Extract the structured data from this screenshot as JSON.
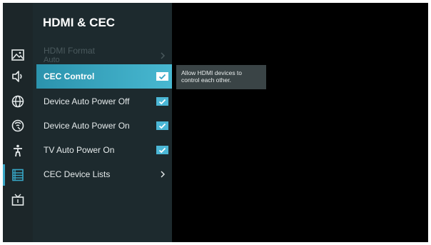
{
  "sidebar": {
    "icons": [
      {
        "name": "picture-icon"
      },
      {
        "name": "sound-icon"
      },
      {
        "name": "network-icon"
      },
      {
        "name": "wifi-settings-icon"
      },
      {
        "name": "accessibility-icon"
      },
      {
        "name": "general-settings-icon",
        "active": true
      },
      {
        "name": "tv-channels-icon"
      }
    ],
    "accent_color": "#37a6c6"
  },
  "menu": {
    "title": "HDMI & CEC",
    "items": [
      {
        "label": "HDMI Format",
        "sub": "Auto",
        "type": "link",
        "disabled": true
      },
      {
        "label": "CEC Control",
        "type": "checkbox",
        "checked": true,
        "selected": true
      },
      {
        "label": "Device Auto Power Off",
        "type": "checkbox",
        "checked": true
      },
      {
        "label": "Device Auto Power On",
        "type": "checkbox",
        "checked": true
      },
      {
        "label": "TV Auto Power On",
        "type": "checkbox",
        "checked": true
      },
      {
        "label": "CEC Device Lists",
        "type": "link"
      }
    ]
  },
  "tooltip": {
    "line1": "Allow HDMI devices to",
    "line2": "control each other."
  }
}
